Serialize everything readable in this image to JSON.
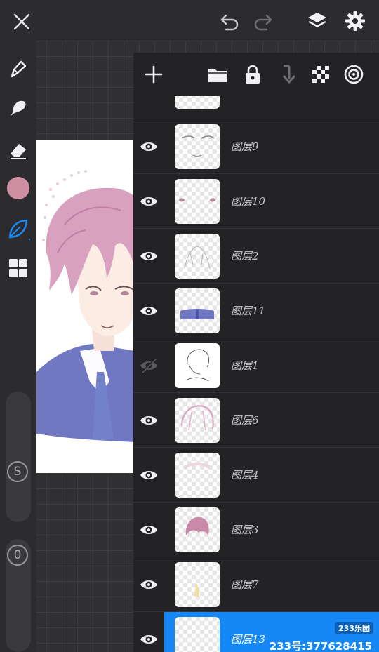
{
  "topbar": {
    "close_icon": "close-icon",
    "undo_icon": "undo-icon",
    "redo_icon": "redo-icon",
    "layers_icon": "layers-icon",
    "settings_icon": "gear-icon"
  },
  "left_toolbar": {
    "tools": [
      "pen-icon",
      "smudge-icon",
      "eraser-icon",
      "color-swatch",
      "brush-leaf-icon",
      "grid-icon"
    ],
    "current_color": "#cf8fa2",
    "size_label": "S",
    "opacity_label": "0"
  },
  "layers_panel": {
    "toolbar_icons": [
      "add-icon",
      "folder-icon",
      "lock-icon",
      "merge-down-icon",
      "transparency-icon",
      "blend-icon"
    ],
    "layers": [
      {
        "name": "图层9",
        "visible": true
      },
      {
        "name": "图层10",
        "visible": true
      },
      {
        "name": "图层2",
        "visible": true
      },
      {
        "name": "图层11",
        "visible": true
      },
      {
        "name": "图层1",
        "visible": false
      },
      {
        "name": "图层6",
        "visible": true
      },
      {
        "name": "图层4",
        "visible": true
      },
      {
        "name": "图层3",
        "visible": true
      },
      {
        "name": "图层7",
        "visible": true
      },
      {
        "name": "图层13",
        "visible": true,
        "selected": true
      }
    ]
  },
  "watermark": {
    "badge": "233乐园",
    "text": "233号:377628415"
  },
  "colors": {
    "accent": "#1688f5",
    "panel_bg": "#232325"
  }
}
